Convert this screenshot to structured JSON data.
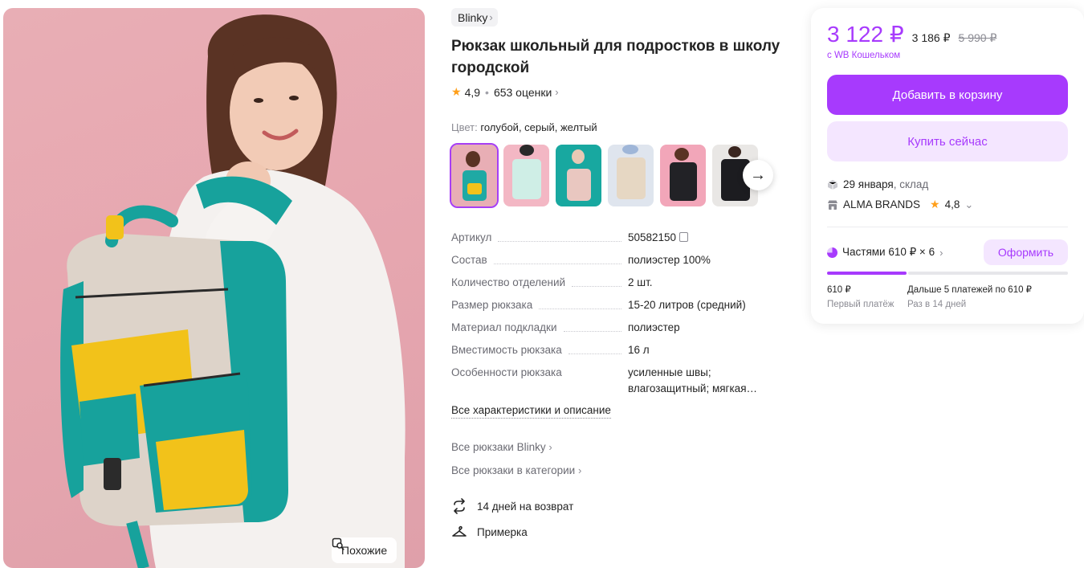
{
  "product": {
    "brand": "Blinky",
    "title": "Рюкзак школьный для подростков в школу городской",
    "rating": "4,9",
    "reviews": "653 оценки"
  },
  "gallery": {
    "similar_label": "Похожие"
  },
  "colors": {
    "label": "Цвет:",
    "value": "голубой, серый, желтый",
    "swatches": [
      {
        "name": "teal-yellow",
        "bg": "#e8aeb5",
        "bag": "#1fa9a4"
      },
      {
        "name": "mint",
        "bg": "#f3b7c4",
        "bag": "#cfeee6"
      },
      {
        "name": "pink-teal",
        "bg": "#18a8a0",
        "bag": "#e9c7c0"
      },
      {
        "name": "beige",
        "bg": "#dfe5ee",
        "bag": "#e6d7c3"
      },
      {
        "name": "black-pink",
        "bg": "#f2a6b9",
        "bag": "#222226"
      },
      {
        "name": "black",
        "bg": "#e9e7e5",
        "bag": "#1c1c20"
      }
    ]
  },
  "specs": [
    {
      "key": "Артикул",
      "value": "50582150"
    },
    {
      "key": "Состав",
      "value": "полиэстер 100%"
    },
    {
      "key": "Количество отделений",
      "value": "2 шт."
    },
    {
      "key": "Размер рюкзака",
      "value": "15-20 литров (средний)"
    },
    {
      "key": "Материал подкладки",
      "value": "полиэстер"
    },
    {
      "key": "Вместимость рюкзака",
      "value": "16 л"
    },
    {
      "key": "Особенности рюкзака",
      "value": "усиленные швы; влагозащитный; мягкая…"
    }
  ],
  "links": {
    "all_specs": "Все характеристики и описание",
    "all_brand": "Все рюкзаки Blinky",
    "all_category": "Все рюкзаки в категории"
  },
  "features": {
    "returns": "14 дней на возврат",
    "fitting": "Примерка"
  },
  "buy": {
    "price": "3 122 ₽",
    "price_regular": "3 186 ₽",
    "price_old": "5 990 ₽",
    "wallet_note": "с WB Кошельком",
    "add_to_cart": "Добавить в корзину",
    "buy_now": "Купить сейчас",
    "delivery_date": "29 января",
    "delivery_place": ", склад",
    "seller": "ALMA BRANDS",
    "seller_rating": "4,8",
    "installments": "Частями 610 ₽ × 6",
    "order_button": "Оформить",
    "installments_paid_fraction": 0.33,
    "first_amount": "610 ₽",
    "first_label": "Первый платёж",
    "rest_amount": "Дальше 5 платежей по 610 ₽",
    "rest_label": "Раз в 14 дней"
  },
  "colors_theme": {
    "accent": "#a73afd",
    "accent_light": "#f4e6ff",
    "star": "#ff9f1a"
  }
}
